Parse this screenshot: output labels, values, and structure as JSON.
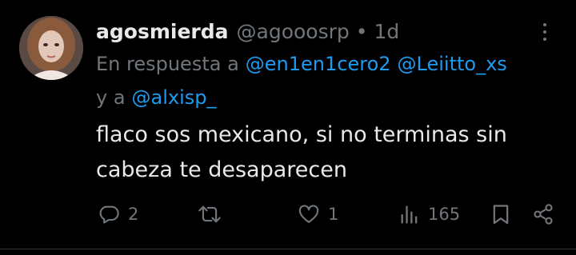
{
  "tweet": {
    "display_name": "agosmierda",
    "handle": "@agooosrp",
    "separator": "•",
    "time": "1d",
    "reply_prefix": "En respuesta a",
    "mentions": [
      "@en1en1cero2",
      "@Leiitto_xs",
      "@alxisp_"
    ],
    "reply_and": "y a",
    "text_line_1": "flaco sos mexicano, si no terminas sin",
    "text_line_2": "cabeza te desaparecen"
  },
  "actions": {
    "replies": "2",
    "retweets": "",
    "likes": "1",
    "views": "165"
  },
  "icons": {
    "reply": "reply-icon",
    "retweet": "retweet-icon",
    "like": "heart-icon",
    "views": "views-icon",
    "bookmark": "bookmark-icon",
    "share": "share-icon",
    "more": "more-icon"
  },
  "colors": {
    "background": "#000000",
    "text_primary": "#e7e9ea",
    "text_secondary": "#71767b",
    "mention": "#1d9bf0"
  }
}
